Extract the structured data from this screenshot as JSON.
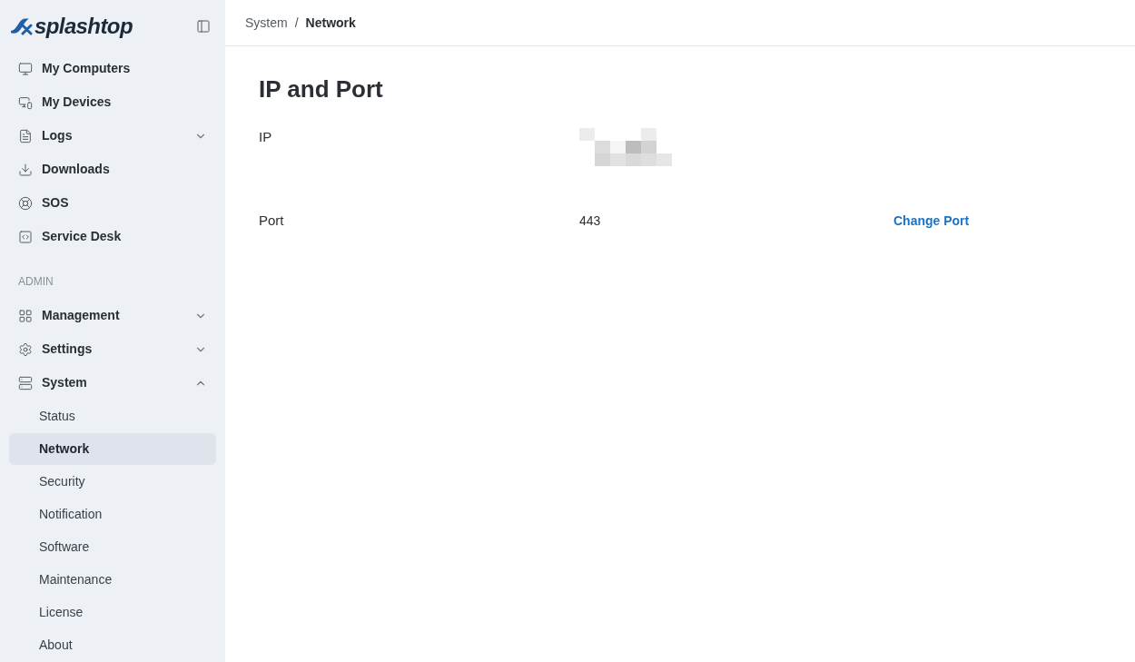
{
  "logo": {
    "text": "splashtop"
  },
  "sidebar": {
    "items": [
      {
        "label": "My Computers"
      },
      {
        "label": "My Devices"
      },
      {
        "label": "Logs",
        "expanded": false
      },
      {
        "label": "Downloads"
      },
      {
        "label": "SOS"
      },
      {
        "label": "Service Desk"
      }
    ],
    "section_label": "ADMIN",
    "admin_items": [
      {
        "label": "Management",
        "expanded": false
      },
      {
        "label": "Settings",
        "expanded": false
      },
      {
        "label": "System",
        "expanded": true,
        "children": [
          {
            "label": "Status",
            "selected": false
          },
          {
            "label": "Network",
            "selected": true
          },
          {
            "label": "Security",
            "selected": false
          },
          {
            "label": "Notification",
            "selected": false
          },
          {
            "label": "Software",
            "selected": false
          },
          {
            "label": "Maintenance",
            "selected": false
          },
          {
            "label": "License",
            "selected": false
          },
          {
            "label": "About",
            "selected": false
          }
        ]
      }
    ]
  },
  "breadcrumb": [
    "System",
    "Network"
  ],
  "breadcrumb_separator": "/",
  "title": "IP and Port",
  "rows": [
    {
      "label": "IP",
      "kind": "redacted"
    },
    {
      "label": "Port",
      "value": "443",
      "action": "Change Port"
    }
  ]
}
